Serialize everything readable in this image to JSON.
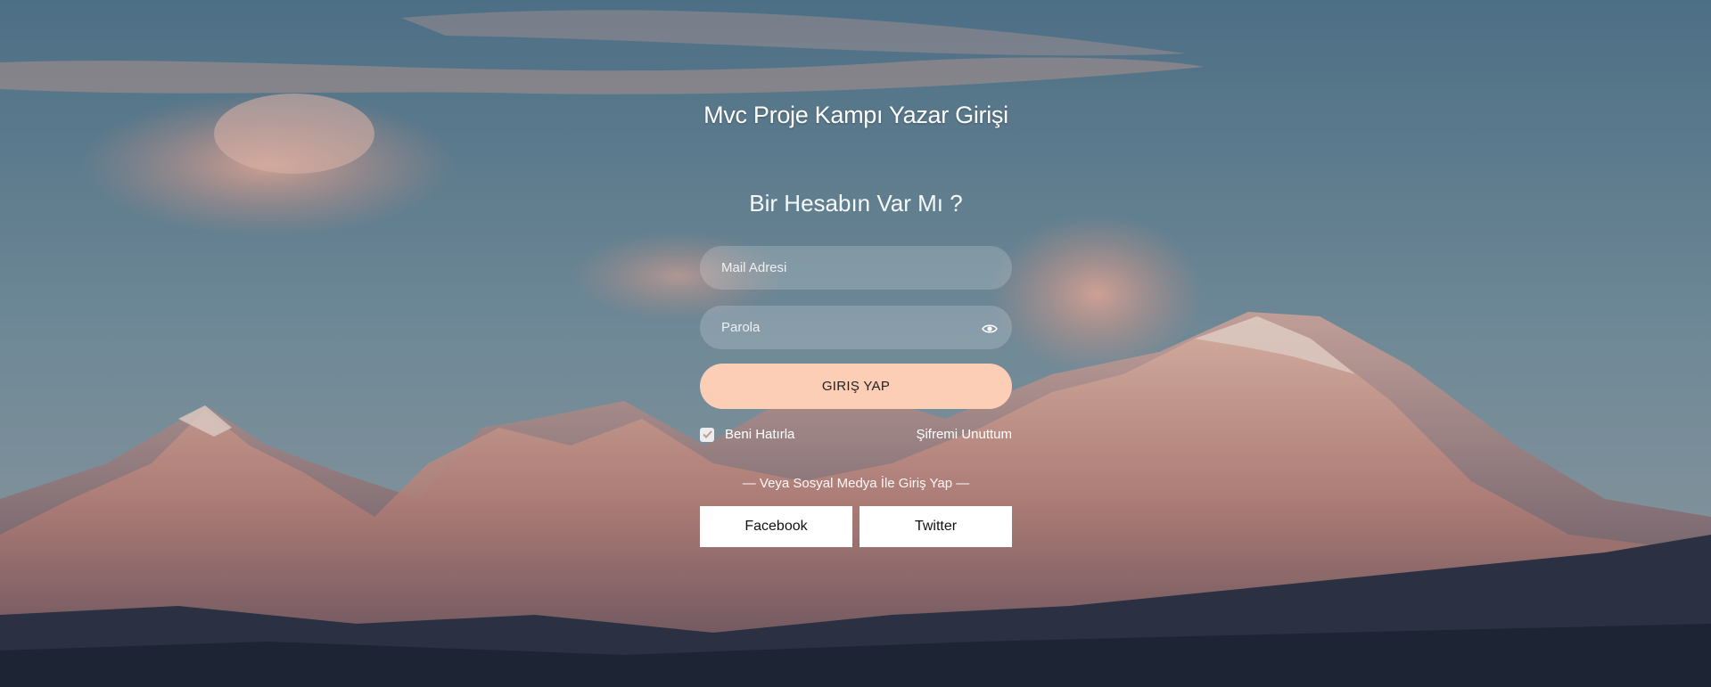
{
  "page": {
    "title": "Mvc Proje Kampı Yazar Girişi",
    "subtitle": "Bir Hesabın Var Mı ?"
  },
  "form": {
    "email_placeholder": "Mail Adresi",
    "password_placeholder": "Parola",
    "submit_label": "GIRIŞ YAP",
    "remember_label": "Beni Hatırla",
    "remember_checked": true,
    "forgot_label": "Şifremi Unuttum"
  },
  "social": {
    "separator": "— Veya Sosyal Medya İle Giriş Yap —",
    "facebook_label": "Facebook",
    "twitter_label": "Twitter"
  },
  "icons": {
    "password_toggle": "eye-icon",
    "remember_check": "check-icon"
  },
  "colors": {
    "accent": "#fbceb5",
    "field_bg": "rgba(255,255,255,0.18)",
    "social_bg": "#ffffff"
  }
}
